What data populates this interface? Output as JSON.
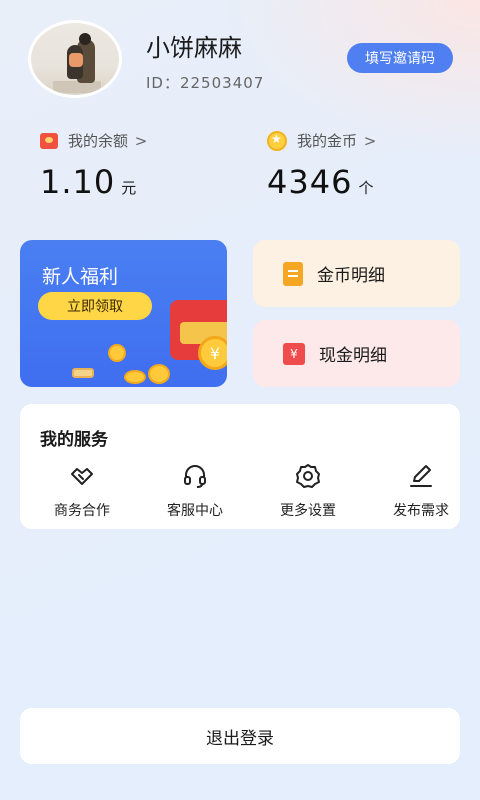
{
  "profile": {
    "nickname": "小饼麻麻",
    "id_text": "ID：22503407",
    "invite_label": "填写邀请码"
  },
  "assets": {
    "balance": {
      "label": "我的余额",
      "arrow": ">",
      "value": "1.10",
      "unit": "元",
      "icon": "red-packet-icon"
    },
    "coins": {
      "label": "我的金币",
      "arrow": ">",
      "value": "4346",
      "unit": "个",
      "icon": "gold-coin-icon"
    }
  },
  "welfare": {
    "title": "新人福利",
    "button": "立即领取",
    "coin_symbol": "¥"
  },
  "details": {
    "coin_detail": {
      "label": "金币明细",
      "icon": "document-icon"
    },
    "cash_detail": {
      "label": "现金明细",
      "icon": "cash-icon",
      "glyph": "¥"
    }
  },
  "services": {
    "title": "我的服务",
    "items": [
      {
        "label": "商务合作",
        "icon": "handshake-icon"
      },
      {
        "label": "客服中心",
        "icon": "headset-icon"
      },
      {
        "label": "更多设置",
        "icon": "gear-icon"
      },
      {
        "label": "发布需求",
        "icon": "pencil-icon"
      }
    ]
  },
  "logout": {
    "label": "退出登录"
  },
  "colors": {
    "accent_blue": "#4f7ff0",
    "welfare_bg": "#4a7ff2",
    "welfare_button": "#ffd646",
    "coin_card_bg": "#fdf1e3",
    "cash_card_bg": "#fde9ea"
  }
}
